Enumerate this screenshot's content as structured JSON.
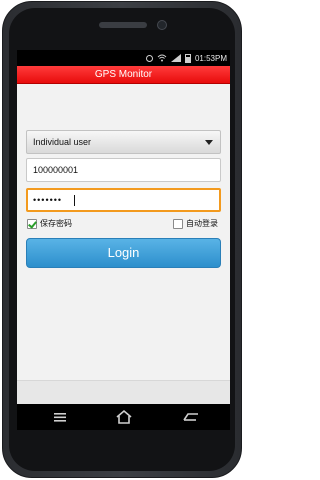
{
  "statusbar": {
    "time": "01:53PM",
    "icons": [
      "alarm-icon",
      "wifi-icon",
      "signal-icon",
      "battery-icon"
    ]
  },
  "app": {
    "title": "GPS Monitor"
  },
  "form": {
    "account_type": "Individual user",
    "username": "100000001",
    "password_masked": "•••••••",
    "save_password_label": "保存密码",
    "save_password_checked": true,
    "auto_login_label": "自动登录",
    "auto_login_checked": false,
    "login_button": "Login"
  },
  "navbar": {
    "icons": [
      "back-icon",
      "home-icon",
      "recent-apps-icon"
    ]
  },
  "colors": {
    "title_red": "#e80c0c",
    "login_blue": "#2d8fcc",
    "focus_orange": "#f39a1e"
  }
}
